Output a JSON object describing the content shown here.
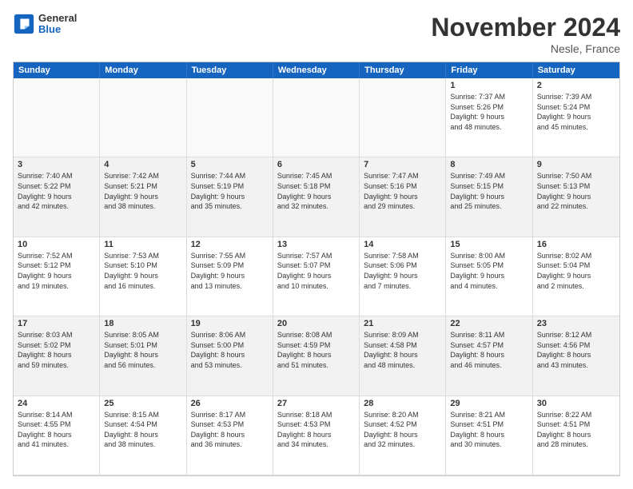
{
  "header": {
    "logo_general": "General",
    "logo_blue": "Blue",
    "month_title": "November 2024",
    "location": "Nesle, France"
  },
  "days_of_week": [
    "Sunday",
    "Monday",
    "Tuesday",
    "Wednesday",
    "Thursday",
    "Friday",
    "Saturday"
  ],
  "weeks": [
    [
      {
        "day": "",
        "info": "",
        "empty": true
      },
      {
        "day": "",
        "info": "",
        "empty": true
      },
      {
        "day": "",
        "info": "",
        "empty": true
      },
      {
        "day": "",
        "info": "",
        "empty": true
      },
      {
        "day": "",
        "info": "",
        "empty": true
      },
      {
        "day": "1",
        "info": "Sunrise: 7:37 AM\nSunset: 5:26 PM\nDaylight: 9 hours\nand 48 minutes."
      },
      {
        "day": "2",
        "info": "Sunrise: 7:39 AM\nSunset: 5:24 PM\nDaylight: 9 hours\nand 45 minutes."
      }
    ],
    [
      {
        "day": "3",
        "info": "Sunrise: 7:40 AM\nSunset: 5:22 PM\nDaylight: 9 hours\nand 42 minutes."
      },
      {
        "day": "4",
        "info": "Sunrise: 7:42 AM\nSunset: 5:21 PM\nDaylight: 9 hours\nand 38 minutes."
      },
      {
        "day": "5",
        "info": "Sunrise: 7:44 AM\nSunset: 5:19 PM\nDaylight: 9 hours\nand 35 minutes."
      },
      {
        "day": "6",
        "info": "Sunrise: 7:45 AM\nSunset: 5:18 PM\nDaylight: 9 hours\nand 32 minutes."
      },
      {
        "day": "7",
        "info": "Sunrise: 7:47 AM\nSunset: 5:16 PM\nDaylight: 9 hours\nand 29 minutes."
      },
      {
        "day": "8",
        "info": "Sunrise: 7:49 AM\nSunset: 5:15 PM\nDaylight: 9 hours\nand 25 minutes."
      },
      {
        "day": "9",
        "info": "Sunrise: 7:50 AM\nSunset: 5:13 PM\nDaylight: 9 hours\nand 22 minutes."
      }
    ],
    [
      {
        "day": "10",
        "info": "Sunrise: 7:52 AM\nSunset: 5:12 PM\nDaylight: 9 hours\nand 19 minutes."
      },
      {
        "day": "11",
        "info": "Sunrise: 7:53 AM\nSunset: 5:10 PM\nDaylight: 9 hours\nand 16 minutes."
      },
      {
        "day": "12",
        "info": "Sunrise: 7:55 AM\nSunset: 5:09 PM\nDaylight: 9 hours\nand 13 minutes."
      },
      {
        "day": "13",
        "info": "Sunrise: 7:57 AM\nSunset: 5:07 PM\nDaylight: 9 hours\nand 10 minutes."
      },
      {
        "day": "14",
        "info": "Sunrise: 7:58 AM\nSunset: 5:06 PM\nDaylight: 9 hours\nand 7 minutes."
      },
      {
        "day": "15",
        "info": "Sunrise: 8:00 AM\nSunset: 5:05 PM\nDaylight: 9 hours\nand 4 minutes."
      },
      {
        "day": "16",
        "info": "Sunrise: 8:02 AM\nSunset: 5:04 PM\nDaylight: 9 hours\nand 2 minutes."
      }
    ],
    [
      {
        "day": "17",
        "info": "Sunrise: 8:03 AM\nSunset: 5:02 PM\nDaylight: 8 hours\nand 59 minutes."
      },
      {
        "day": "18",
        "info": "Sunrise: 8:05 AM\nSunset: 5:01 PM\nDaylight: 8 hours\nand 56 minutes."
      },
      {
        "day": "19",
        "info": "Sunrise: 8:06 AM\nSunset: 5:00 PM\nDaylight: 8 hours\nand 53 minutes."
      },
      {
        "day": "20",
        "info": "Sunrise: 8:08 AM\nSunset: 4:59 PM\nDaylight: 8 hours\nand 51 minutes."
      },
      {
        "day": "21",
        "info": "Sunrise: 8:09 AM\nSunset: 4:58 PM\nDaylight: 8 hours\nand 48 minutes."
      },
      {
        "day": "22",
        "info": "Sunrise: 8:11 AM\nSunset: 4:57 PM\nDaylight: 8 hours\nand 46 minutes."
      },
      {
        "day": "23",
        "info": "Sunrise: 8:12 AM\nSunset: 4:56 PM\nDaylight: 8 hours\nand 43 minutes."
      }
    ],
    [
      {
        "day": "24",
        "info": "Sunrise: 8:14 AM\nSunset: 4:55 PM\nDaylight: 8 hours\nand 41 minutes."
      },
      {
        "day": "25",
        "info": "Sunrise: 8:15 AM\nSunset: 4:54 PM\nDaylight: 8 hours\nand 38 minutes."
      },
      {
        "day": "26",
        "info": "Sunrise: 8:17 AM\nSunset: 4:53 PM\nDaylight: 8 hours\nand 36 minutes."
      },
      {
        "day": "27",
        "info": "Sunrise: 8:18 AM\nSunset: 4:53 PM\nDaylight: 8 hours\nand 34 minutes."
      },
      {
        "day": "28",
        "info": "Sunrise: 8:20 AM\nSunset: 4:52 PM\nDaylight: 8 hours\nand 32 minutes."
      },
      {
        "day": "29",
        "info": "Sunrise: 8:21 AM\nSunset: 4:51 PM\nDaylight: 8 hours\nand 30 minutes."
      },
      {
        "day": "30",
        "info": "Sunrise: 8:22 AM\nSunset: 4:51 PM\nDaylight: 8 hours\nand 28 minutes."
      }
    ]
  ]
}
